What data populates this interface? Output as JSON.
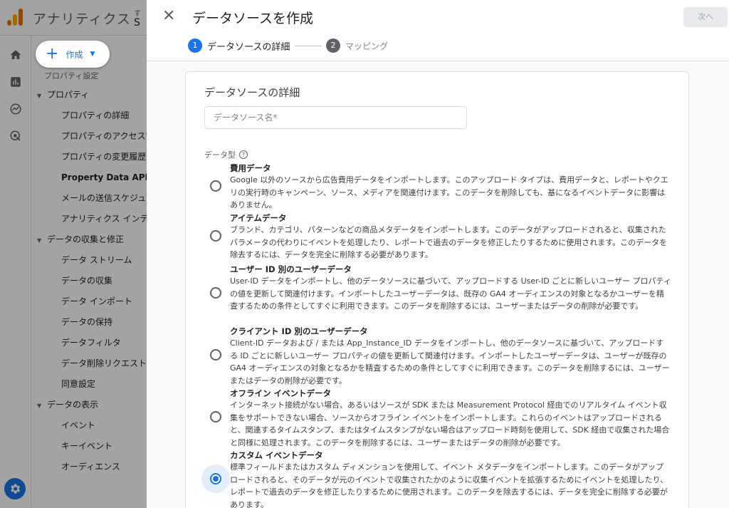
{
  "app": {
    "title": "アナリティクス",
    "account_line1": "す",
    "account_line2": "S"
  },
  "rail": {
    "icons": [
      "home-icon",
      "reports-icon",
      "explore-icon",
      "advertising-icon"
    ],
    "settings_icon": "settings-gear-icon"
  },
  "sidebar": {
    "create_label": "作成",
    "property_settings": "プロパティ設定",
    "sections": [
      {
        "label": "プロパティ",
        "items": [
          "プロパティの詳細",
          "プロパティのアクセス管",
          "プロパティの変更履歴",
          "Property Data API の割",
          "メールの送信スケジュー",
          "アナリティクス インテ"
        ]
      },
      {
        "label": "データの収集と修正",
        "items": [
          "データ ストリーム",
          "データの収集",
          "データ インポート",
          "データの保持",
          "データフィルタ",
          "データ削除リクエスト",
          "同意設定"
        ]
      },
      {
        "label": "データの表示",
        "items": [
          "イベント",
          "キーイベント",
          "オーディエンス"
        ]
      }
    ]
  },
  "dialog": {
    "title": "データソースを作成",
    "next_label": "次へ",
    "steps": [
      {
        "num": "1",
        "label": "データソースの詳細"
      },
      {
        "num": "2",
        "label": "マッピング"
      }
    ],
    "card_title": "データソースの詳細",
    "name_placeholder": "データソース名*",
    "type_label": "データ型",
    "options": [
      {
        "title": "費用データ",
        "desc": "Google 以外のソースから広告費用データをインポートします。このアップロード タイプは、費用データと、レポートやクエリの実行時のキャンペーン、ソース、メディアを関連付けます。このデータを削除しても、基になるイベントデータに影響はありません。",
        "checked": false
      },
      {
        "title": "アイテムデータ",
        "desc": "ブランド、カテゴリ、パターンなどの商品メタデータをインポートします。このデータがアップロードされると、収集されたパラメータの代わりにイベントを処理したり、レポートで過去のデータを修正したりするために使用されます。このデータを除去するには、データを完全に削除する必要があります。",
        "checked": false
      },
      {
        "title": "ユーザー ID 別のユーザーデータ",
        "desc": "User-ID データをインポートし、他のデータソースに基づいて、アップロードする User-ID ごとに新しいユーザー プロパティの値を更新して関連付けます。インポートしたユーザーデータは、既存の GA4 オーディエンスの対象となるかユーザーを精査するための条件としてすぐに利用できます。このデータを削除するには、ユーザーまたはデータの削除が必要です。",
        "checked": false
      },
      {
        "title": "クライアント ID 別のユーザーデータ",
        "desc": "Client-ID データおよび / または App_Instance_ID データをインポートし、他のデータソースに基づいて、アップロードする ID ごとに新しいユーザー プロパティの値を更新して関連付けます。インポートしたユーザーデータは、ユーザーが既存の GA4 オーディエンスの対象となるかを精査するための条件としてすぐに利用できます。このデータを削除するには、ユーザーまたはデータの削除が必要です。",
        "checked": false
      },
      {
        "title": "オフライン イベントデータ",
        "desc": "インターネット接続がない場合、あるいはソースが SDK または Measurement Protocol 経由でのリアルタイム イベント収集をサポートできない場合、ソースからオフライン イベントをインポートします。これらのイベントはアップロードされると、関連するタイムスタンプ、またはタイムスタンプがない場合はアップロード時刻を使用して、SDK 経由で収集された場合と同様に処理されます。このデータを削除するには、ユーザーまたはデータの削除が必要です。",
        "checked": false
      },
      {
        "title": "カスタム イベントデータ",
        "desc": "標準フィールドまたはカスタム ディメンションを使用して、イベント メタデータをインポートします。このデータがアップロードされると、そのデータが元のイベントで収集されたかのように収集イベントを拡張するためにイベントを処理したり、レポートで過去のデータを修正したりするために使用されます。このデータを除去するには、データを完全に削除する必要があります。",
        "checked": true
      }
    ]
  }
}
